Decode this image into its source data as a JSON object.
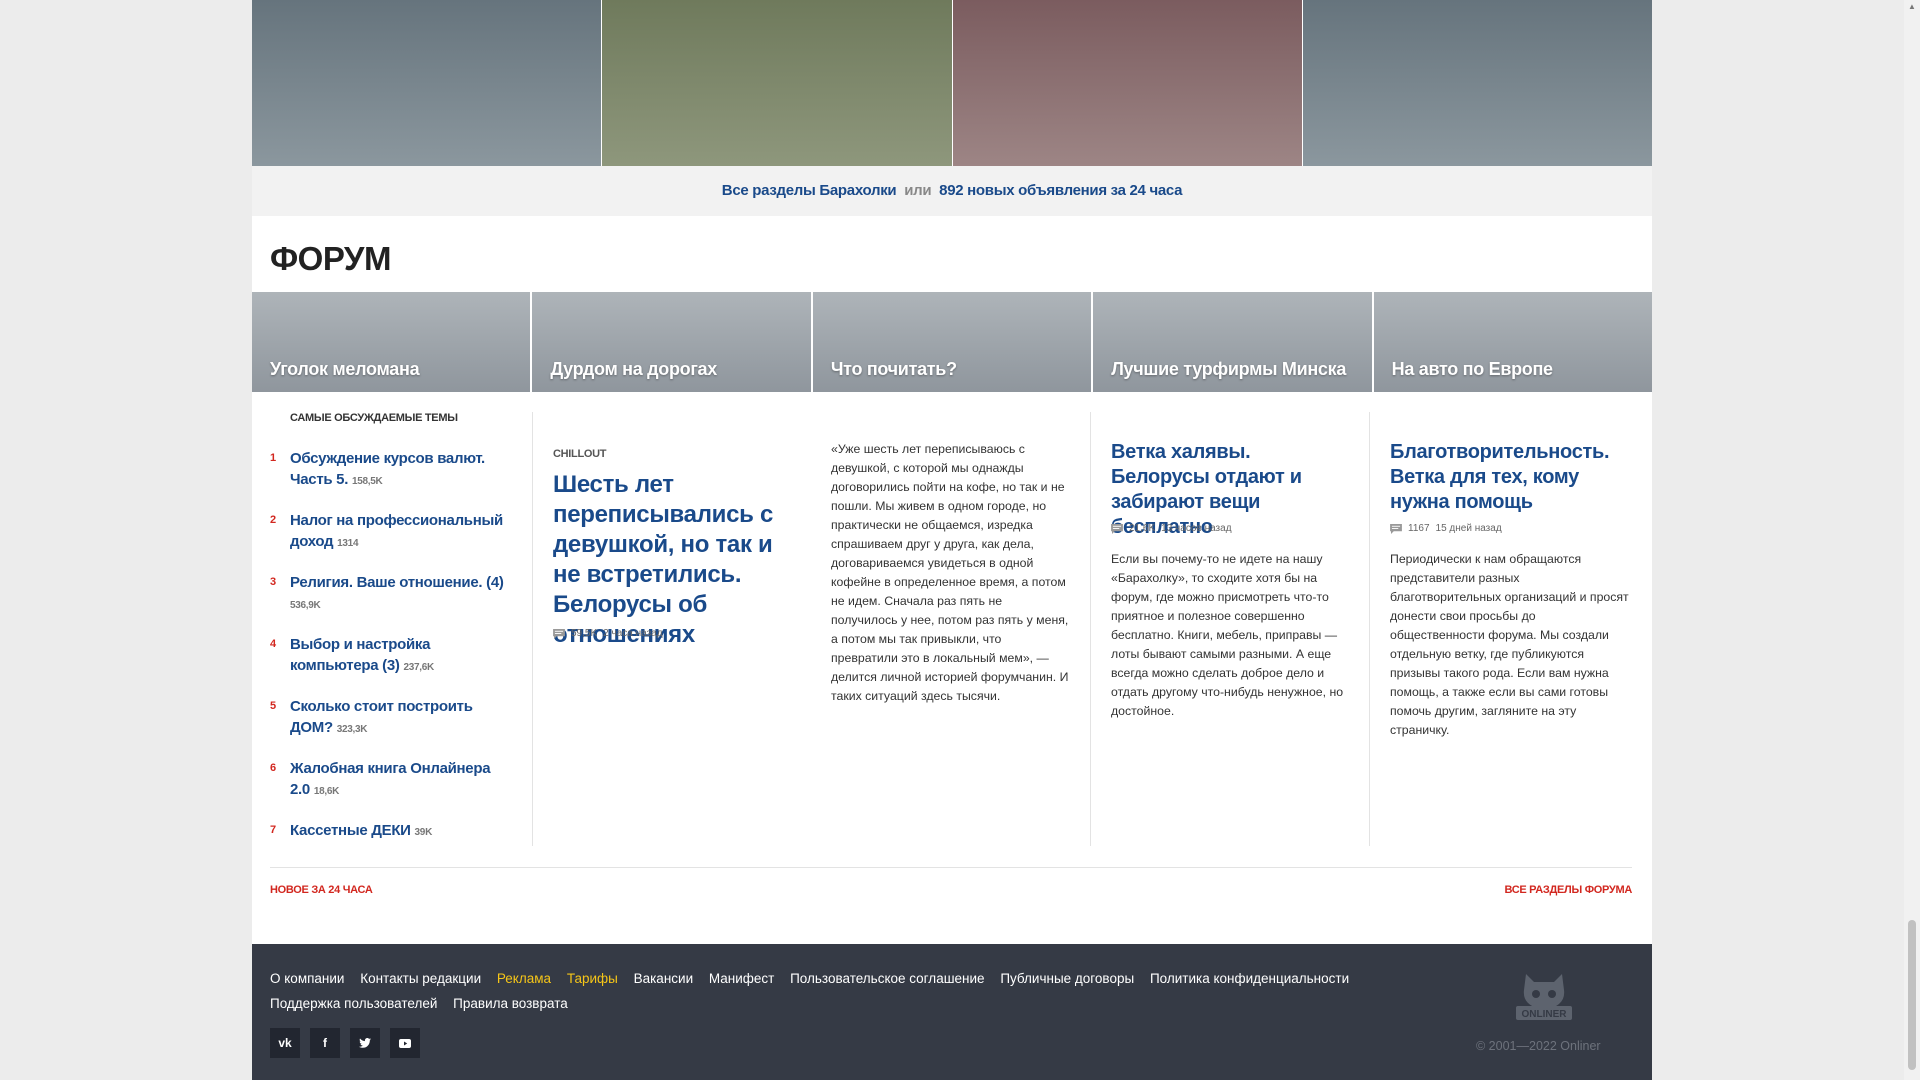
{
  "baraholka": {
    "tiles": [
      {
        "color_top": "#66747d",
        "color_bottom": "#8b979e"
      },
      {
        "color_top": "#6f7a5c",
        "color_bottom": "#8e977c"
      },
      {
        "color_top": "#7b5c5f",
        "color_bottom": "#9d8585"
      },
      {
        "color_top": "#66747d",
        "color_bottom": "#8b979e"
      }
    ],
    "all_sections_link": "Все разделы Барахолки",
    "or_text": "или",
    "new_ads_link": "892 новых объявления за 24 часа"
  },
  "forum": {
    "title": "ФОРУМ",
    "tabs": [
      "Уголок меломана",
      "Дурдом на дорогах",
      "Что почитать?",
      "Лучшие турфирмы Минска",
      "На авто по Европе"
    ],
    "top_topics": {
      "heading": "Самые обсуждаемые темы",
      "items": [
        {
          "num": "1",
          "title": "Обсуждение курсов валют. Часть 5.",
          "count": "158,5K"
        },
        {
          "num": "2",
          "title": "Налог на профессиональный доход",
          "count": "1314"
        },
        {
          "num": "3",
          "title": "Религия. Ваше отношение. (4)",
          "count": "536,9K"
        },
        {
          "num": "4",
          "title": "Выбор и настройка компьютера (3)",
          "count": "237,6K"
        },
        {
          "num": "5",
          "title": "Сколько стоит построить ДОМ?",
          "count": "323,3K"
        },
        {
          "num": "6",
          "title": "Жалобная книга Онлайнера 2.0",
          "count": "18,6K"
        },
        {
          "num": "7",
          "title": "Кассетные ДЕКИ",
          "count": "39K"
        }
      ]
    },
    "featured": {
      "tag": "CHILLOUT",
      "headline": "Шесть лет переписывались с девушкой, но так и не встретились. Белорусы об отношениях",
      "comments": "59,5K",
      "time": "2 часа назад",
      "quote": "«Уже шесть лет переписываюсь с девушкой, с которой мы однажды договорились пойти на кофе, но так и не пошли. Мы живем в одном городе, но практически не общаемся, изредка спрашиваем друг у друга, как дела, договариваемся увидеться в одной кофейне в определенное время, а потом не идем. Сначала раз пять не получилось у нее, потом раз пять у меня, а потом мы так привыкли, что превратили это в локальный мем», — делится личной историей форумчанин. И таких ситуаций здесь тысячи."
    },
    "card4": {
      "title": "Ветка халявы. Белорусы отдают и забирают вещи бесплатно",
      "comments": "21,6K",
      "time": "13 часов назад",
      "desc": "Если вы почему-то не идете на нашу «Барахолку», то сходите хотя бы на форум, где можно присмотреть что-то приятное и полезное совершенно бесплатно. Книги, мебель, приправы — лоты бывают самыми разными. А еще всегда можно сделать доброе дело и отдать другому что-нибудь ненужное, но достойное."
    },
    "card5": {
      "title": "Благотворительность. Ветка для тех, кому нужна помощь",
      "comments": "1167",
      "time": "15 дней назад",
      "desc": "Периодически к нам обращаются представители разных благотворительных организаций и просят донести свои просьбы до общественности форума. Мы создали отдельную ветку, где публикуются призывы такого рода. Если вам нужна помощь, а также если вы сами готовы помочь другим, загляните на эту страничку."
    },
    "new_24h": "Новое за 24 часа",
    "all_sections": "Все разделы форума"
  },
  "footer": {
    "links": [
      {
        "label": "О компании",
        "highlight": false
      },
      {
        "label": "Контакты редакции",
        "highlight": false
      },
      {
        "label": "Реклама",
        "highlight": true
      },
      {
        "label": "Тарифы",
        "highlight": true
      },
      {
        "label": "Вакансии",
        "highlight": false
      },
      {
        "label": "Манифест",
        "highlight": false
      },
      {
        "label": "Пользовательское соглашение",
        "highlight": false
      },
      {
        "label": "Публичные договоры",
        "highlight": false
      },
      {
        "label": "Политика конфиденциальности",
        "highlight": false
      },
      {
        "label": "Поддержка пользователей",
        "highlight": false
      },
      {
        "label": "Правила возврата",
        "highlight": false
      }
    ],
    "social": [
      "vk-icon",
      "facebook-icon",
      "twitter-icon",
      "youtube-icon"
    ],
    "logo_text": "ONLINER",
    "copyright": "© 2001—2022 Onliner"
  },
  "colors": {
    "link_blue": "#1a4a8a",
    "accent_red": "#d2271f",
    "footer_bg": "#353a45",
    "highlight_yellow": "#f5c518"
  }
}
